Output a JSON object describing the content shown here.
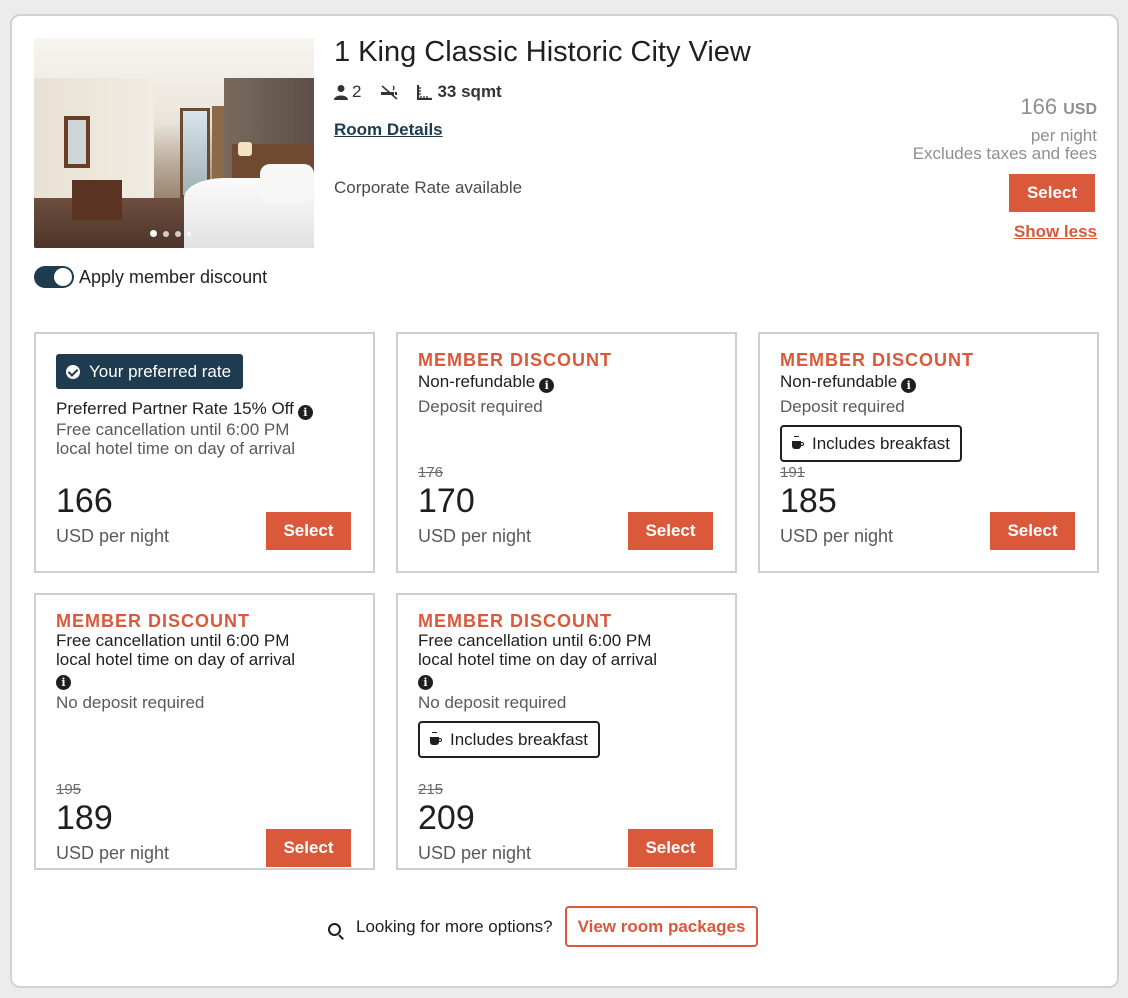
{
  "room": {
    "title": "1 King Classic Historic City View",
    "guests": "2",
    "size": "33 sqmt",
    "details_link": "Room Details",
    "corporate_rate": "Corporate Rate available",
    "price": "166",
    "currency": "USD",
    "per_night": "per night",
    "excludes": "Excludes taxes and fees",
    "select_label": "Select",
    "show_less": "Show less",
    "photo_slides": 4,
    "photo_active_slide": 1
  },
  "member_toggle": {
    "label": "Apply member discount",
    "checked": true
  },
  "rates": [
    {
      "badge": "Your preferred rate",
      "name": "Preferred Partner Rate 15% Off",
      "cancellation": [
        "Free cancellation until 6:00 PM",
        "local hotel time on day of arrival"
      ],
      "price": "166",
      "per_night": "USD per night",
      "select": "Select"
    },
    {
      "heading": "MEMBER DISCOUNT",
      "policy": "Non-refundable",
      "deposit": "Deposit required",
      "old_price": "176",
      "price": "170",
      "per_night": "USD per night",
      "select": "Select"
    },
    {
      "heading": "MEMBER DISCOUNT",
      "policy": "Non-refundable",
      "deposit": "Deposit required",
      "breakfast": "Includes breakfast",
      "old_price": "191",
      "price": "185",
      "per_night": "USD per night",
      "select": "Select"
    },
    {
      "heading": "MEMBER DISCOUNT",
      "policy": [
        "Free cancellation until 6:00 PM",
        "local hotel time on day of arrival"
      ],
      "deposit": "No deposit required",
      "old_price": "195",
      "price": "189",
      "per_night": "USD per night",
      "select": "Select"
    },
    {
      "heading": "MEMBER DISCOUNT",
      "policy": [
        "Free cancellation until 6:00 PM",
        "local hotel time on day of arrival"
      ],
      "deposit": "No deposit required",
      "breakfast": "Includes breakfast",
      "old_price": "215",
      "price": "209",
      "per_night": "USD per night",
      "select": "Select"
    }
  ],
  "more_options": {
    "text": "Looking for more options?",
    "button": "View room packages"
  },
  "colors": {
    "accent": "#d9593a",
    "navy": "#1e3b4f",
    "border": "#cfcfcf"
  },
  "icons": [
    "person-icon",
    "no-smoking-icon",
    "room-size-icon",
    "info-icon",
    "check-circle-icon",
    "coffee-cup-icon",
    "search-icon"
  ]
}
